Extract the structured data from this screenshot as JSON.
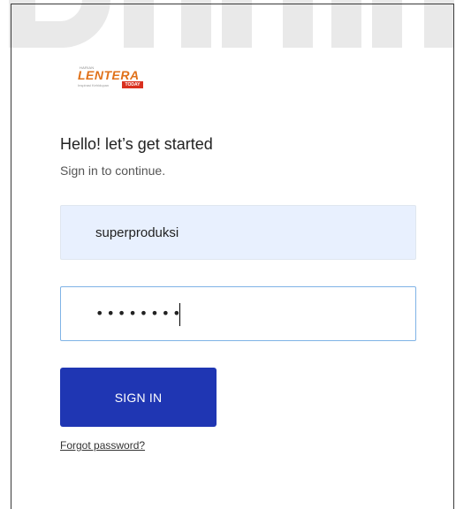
{
  "logo": {
    "brand": "LENTERA",
    "small_text": "HARIAN",
    "tagline": "Inspirasi Kehidupan",
    "badge": "TODAY"
  },
  "login": {
    "greeting": "Hello! let’s get started",
    "subtitle": "Sign in to continue.",
    "username_value": "superproduksi",
    "password_mask": "••••••••",
    "signin_label": "SIGN IN",
    "forgot_label": "Forgot password?"
  },
  "colors": {
    "primary_button": "#1f36b3",
    "input_autofill_bg": "#e8f0fe",
    "input_focus_border": "#7fb3e6",
    "logo_orange": "#e0711a",
    "logo_red": "#d9301f"
  }
}
